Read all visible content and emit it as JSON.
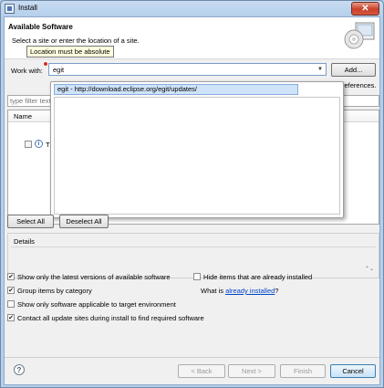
{
  "window": {
    "title": "Install",
    "close_glyph": "✕"
  },
  "banner": {
    "title": "Available Software",
    "description": "Select a site or enter the location of a site.",
    "icon": "cd-install-icon"
  },
  "tooltip": {
    "text": "Location must be absolute"
  },
  "work_with": {
    "label": "Work with:",
    "value": "egit",
    "add_label": "Add...",
    "references_text": "references."
  },
  "dropdown": {
    "items": [
      "egit - http://download.eclipse.org/egit/updates/"
    ]
  },
  "filter": {
    "placeholder": "type filter text"
  },
  "table": {
    "columns": [
      "Name"
    ],
    "rows": [
      {
        "text": "Th"
      }
    ]
  },
  "buttons": {
    "select_all": "Select All",
    "deselect_all": "Deselect All",
    "back": "< Back",
    "next": "Next >",
    "finish": "Finish",
    "cancel": "Cancel"
  },
  "details": {
    "label": "Details"
  },
  "options": {
    "latest_versions": {
      "label": "Show only the latest versions of available software",
      "checked": true
    },
    "hide_installed": {
      "label": "Hide items that are already installed",
      "checked": false
    },
    "group_by_category": {
      "label": "Group items by category",
      "checked": true
    },
    "what_is_prefix": "What is ",
    "what_is_link": "already installed",
    "what_is_suffix": "?",
    "target_env": {
      "label": "Show only software applicable to target environment",
      "checked": false
    },
    "contact_sites": {
      "label": "Contact all update sites during install to find required software",
      "checked": true
    }
  },
  "colors": {
    "titlebar": "#b5cfeb",
    "close_button": "#c9402a",
    "selection": "#cfe3f8",
    "link": "#0044cc",
    "error": "#d72b1f"
  }
}
